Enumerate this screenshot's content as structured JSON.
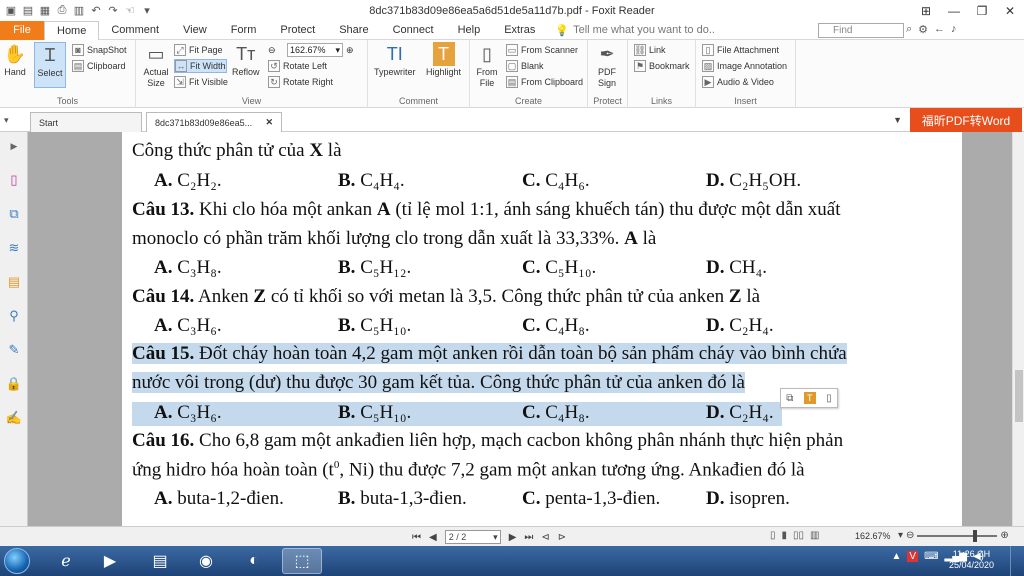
{
  "window": {
    "title": "8dc371b83d09e86ea5a6d51de5a11d7b.pdf - Foxit Reader"
  },
  "menu": {
    "file": "File",
    "tabs": [
      "Home",
      "Comment",
      "View",
      "Form",
      "Protect",
      "Share",
      "Connect",
      "Help",
      "Extras"
    ],
    "tell_me": "Tell me what you want to do..",
    "find_placeholder": "Find"
  },
  "ribbon": {
    "tools": {
      "hand": "Hand",
      "select": "Select",
      "snapshot": "SnapShot",
      "clipboard": "Clipboard",
      "label": "Tools"
    },
    "view": {
      "actual_size": "Actual Size",
      "fit_page": "Fit Page",
      "fit_width": "Fit Width",
      "fit_visible": "Fit Visible",
      "reflow": "Reflow",
      "zoom": "162.67%",
      "rotate_left": "Rotate Left",
      "rotate_right": "Rotate Right",
      "label": "View"
    },
    "comment": {
      "typewriter": "Typewriter",
      "highlight": "Highlight",
      "label": "Comment"
    },
    "create": {
      "from_file": "From File",
      "from_scanner": "From Scanner",
      "blank": "Blank",
      "from_clipboard": "From Clipboard",
      "label": "Create"
    },
    "protect": {
      "pdf_sign": "PDF Sign",
      "label": "Protect"
    },
    "links": {
      "link": "Link",
      "bookmark": "Bookmark",
      "label": "Links"
    },
    "insert": {
      "file_attachment": "File Attachment",
      "image_annotation": "Image Annotation",
      "audio_video": "Audio & Video",
      "label": "Insert"
    }
  },
  "tabs": {
    "start": "Start",
    "doc": "8dc371b83d09e86ea5...",
    "convert": "福昕PDF转Word"
  },
  "document": {
    "q12_stem": "Công thức phân tử của ",
    "q12_var": "X",
    "q12_end": " là",
    "q12_answers": [
      "C₂H₂.",
      "C₄H₄.",
      "C₄H₆.",
      "C₂H₅OH."
    ],
    "q13_label": "Câu 13.",
    "q13_line1a": " Khi clo hóa một ankan ",
    "q13_var": "A",
    "q13_line1b": " (tỉ lệ mol 1:1, ánh sáng khuếch tán) thu được một dẫn xuất",
    "q13_line2a": "monoclo có phần trăm khối lượng clo trong dẫn xuất là 33,33%. ",
    "q13_line2b": " là",
    "q13_answers": [
      "C₃H₈.",
      "C₅H₁₂.",
      "C₅H₁₀.",
      "CH₄."
    ],
    "q14_label": "Câu 14.",
    "q14_a": " Anken ",
    "q14_var": "Z",
    "q14_b": " có tỉ khối so với metan là 3,5. Công thức phân tử của anken ",
    "q14_c": " là",
    "q14_answers": [
      "C₃H₆.",
      "C₅H₁₀.",
      "C₄H₈.",
      "C₂H₄."
    ],
    "q15_label": "Câu 15.",
    "q15_line1": " Đốt cháy hoàn toàn 4,2 gam một anken rồi dẫn toàn bộ sản phẩm cháy vào bình chứa",
    "q15_line2": "nước vôi trong (dư) thu được 30 gam kết tủa. Công thức phân tử của anken đó là",
    "q15_answers": [
      "C₃H₆.",
      "C₅H₁₀.",
      "C₄H₈.",
      "C₂H₄."
    ],
    "q16_label": "Câu 16.",
    "q16_line1": " Cho 6,8 gam một ankađien liên hợp, mạch cacbon không phân nhánh thực hiện phản",
    "q16_line2a": "ứng hidro hóa hoàn toàn (t",
    "q16_sup": "0",
    "q16_line2b": ", Ni) thu được 7,2 gam một ankan tương ứng. Ankađien đó là",
    "q16_answers": [
      "buta-1,2-đien.",
      "buta-1,3-đien.",
      "penta-1,3-đien.",
      "isopren."
    ],
    "option_letters": [
      "A.",
      "B.",
      "C.",
      "D."
    ]
  },
  "status": {
    "page": "2 / 2",
    "zoom": "162.67%"
  },
  "taskbar": {
    "time": "11:26 CH",
    "date": "25/04/2020"
  }
}
